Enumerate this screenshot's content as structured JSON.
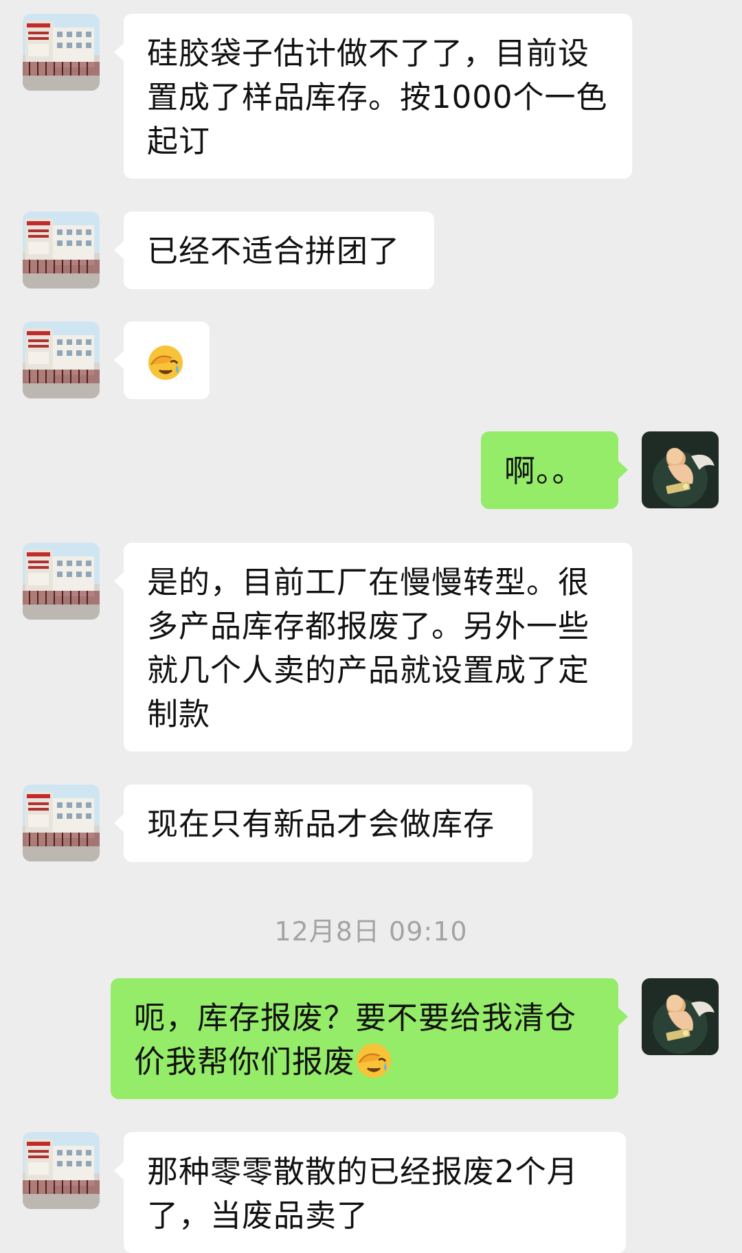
{
  "messages": [
    {
      "side": "in",
      "text": "硅胶袋子估计做不了了，目前设置成了样品库存。按1000个一色起订"
    },
    {
      "side": "in",
      "text": "已经不适合拼团了"
    },
    {
      "side": "in",
      "emoji": "facepalm-crying-emoji"
    },
    {
      "side": "out",
      "text": "啊。。"
    },
    {
      "side": "in",
      "text": "是的，目前工厂在慢慢转型。很多产品库存都报废了。另外一些就几个人卖的产品就设置成了定制款"
    },
    {
      "side": "in",
      "text": "现在只有新品才会做库存"
    },
    {
      "side": "out",
      "text": "呃，库存报废？要不要给我清仓价我帮你们报废",
      "emoji": "facepalm-crying-emoji"
    },
    {
      "side": "in",
      "text": "那种零零散散的已经报废2个月了，当废品卖了"
    }
  ],
  "timestamp": "12月8日 09:10",
  "colors": {
    "background": "#ededed",
    "incoming_bubble": "#ffffff",
    "outgoing_bubble": "#95ec69",
    "timestamp": "#a3a3a3"
  }
}
